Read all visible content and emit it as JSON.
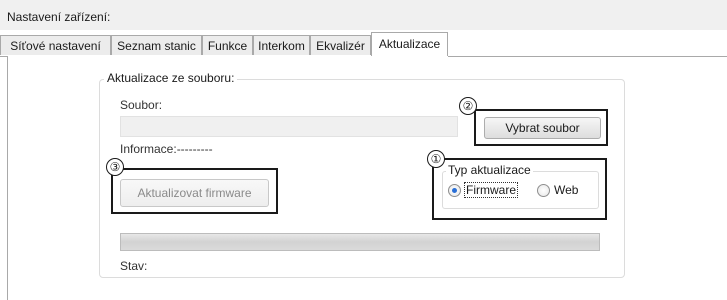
{
  "window": {
    "title": "Nastavení zařízení:"
  },
  "tabs": [
    {
      "label": "Síťové nastavení",
      "active": false
    },
    {
      "label": "Seznam stanic",
      "active": false
    },
    {
      "label": "Funkce",
      "active": false
    },
    {
      "label": "Interkom",
      "active": false
    },
    {
      "label": "Ekvalizér",
      "active": false
    },
    {
      "label": "Aktualizace",
      "active": true
    }
  ],
  "update_group": {
    "title": "Aktualizace ze souboru:",
    "file_label": "Soubor:",
    "file_value": "",
    "select_button": "Vybrat soubor",
    "info_label": "Informace:---------",
    "update_button": "Aktualizovat firmware",
    "update_button_enabled": false,
    "type_group": {
      "title": "Typ aktualizace",
      "options": [
        {
          "label": "Firmware",
          "checked": true
        },
        {
          "label": "Web",
          "checked": false
        }
      ]
    },
    "progress": 0,
    "status_label": "Stav:"
  },
  "callouts": [
    "①",
    "②",
    "③"
  ]
}
